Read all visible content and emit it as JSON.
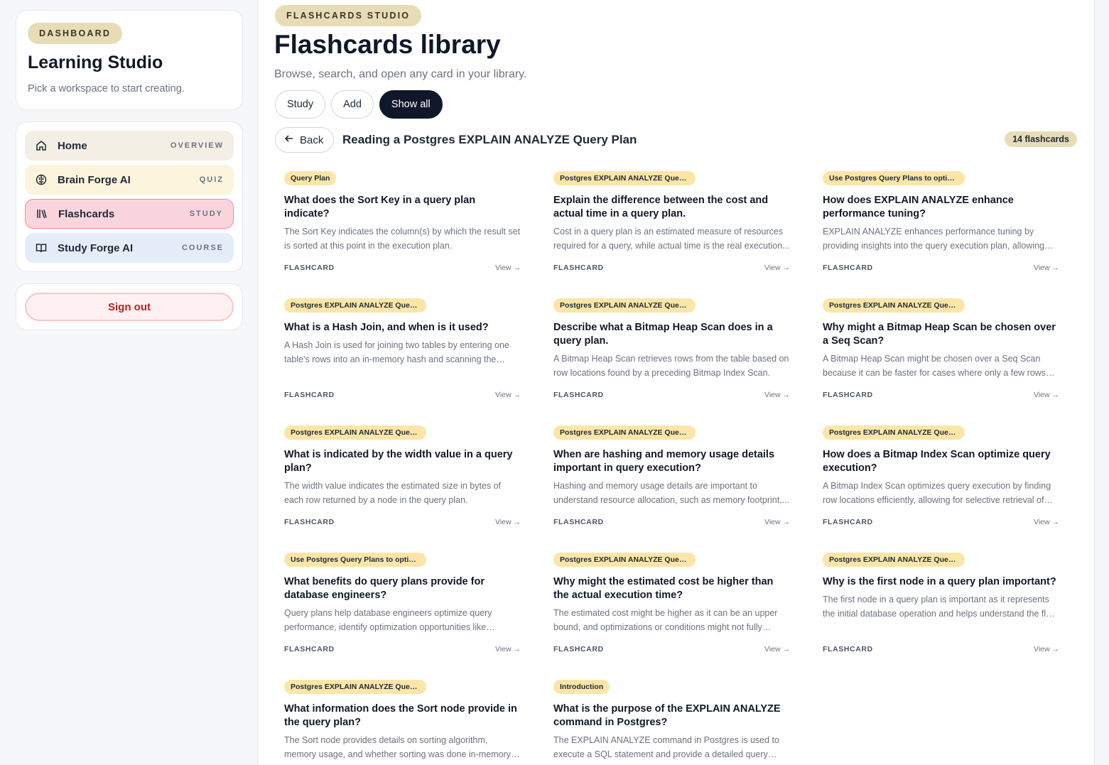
{
  "sidebar": {
    "badge": "DASHBOARD",
    "title": "Learning Studio",
    "subtitle": "Pick a workspace to start creating.",
    "nav": [
      {
        "label": "Home",
        "tag": "OVERVIEW",
        "icon": "home-icon"
      },
      {
        "label": "Brain Forge AI",
        "tag": "QUIZ",
        "icon": "brain-icon"
      },
      {
        "label": "Flashcards",
        "tag": "STUDY",
        "icon": "library-icon"
      },
      {
        "label": "Study Forge AI",
        "tag": "COURSE",
        "icon": "book-icon"
      }
    ],
    "signout": "Sign out"
  },
  "header": {
    "badge": "FLASHCARDS STUDIO",
    "title": "Flashcards library",
    "subtitle": "Browse, search, and open any card in your library.",
    "tabs": [
      "Study",
      "Add",
      "Show all"
    ],
    "active_tab": "Show all"
  },
  "deck": {
    "back_label": "Back",
    "title": "Reading a Postgres EXPLAIN ANALYZE Query Plan",
    "count": "14 flashcards"
  },
  "card_labels": {
    "kind": "FLASHCARD",
    "view": "View →"
  },
  "cards": [
    {
      "tag": "Query Plan",
      "question": "What does the Sort Key in a query plan indicate?",
      "answer": "The Sort Key indicates the column(s) by which the result set is sorted at this point in the execution plan."
    },
    {
      "tag": "Postgres EXPLAIN ANALYZE Query...",
      "question": "Explain the difference between the cost and actual time in a query plan.",
      "answer": "Cost in a query plan is an estimated measure of resources required for a query, while actual time is the real execution..."
    },
    {
      "tag": "Use Postgres Query Plans to optimi...",
      "question": "How does EXPLAIN ANALYZE enhance performance tuning?",
      "answer": "EXPLAIN ANALYZE enhances performance tuning by providing insights into the query execution plan, allowing for..."
    },
    {
      "tag": "Postgres EXPLAIN ANALYZE Query...",
      "question": "What is a Hash Join, and when is it used?",
      "answer": "A Hash Join is used for joining two tables by entering one table's rows into an in-memory hash and scanning the other..."
    },
    {
      "tag": "Postgres EXPLAIN ANALYZE Query...",
      "question": "Describe what a Bitmap Heap Scan does in a query plan.",
      "answer": "A Bitmap Heap Scan retrieves rows from the table based on row locations found by a preceding Bitmap Index Scan."
    },
    {
      "tag": "Postgres EXPLAIN ANALYZE Query...",
      "question": "Why might a Bitmap Heap Scan be chosen over a Seq Scan?",
      "answer": "A Bitmap Heap Scan might be chosen over a Seq Scan because it can be faster for cases where only a few rows nee..."
    },
    {
      "tag": "Postgres EXPLAIN ANALYZE Query...",
      "question": "What is indicated by the width value in a query plan?",
      "answer": "The width value indicates the estimated size in bytes of each row returned by a node in the query plan."
    },
    {
      "tag": "Postgres EXPLAIN ANALYZE Query...",
      "question": "When are hashing and memory usage details important in query execution?",
      "answer": "Hashing and memory usage details are important to understand resource allocation, such as memory footprint,..."
    },
    {
      "tag": "Postgres EXPLAIN ANALYZE Query...",
      "question": "How does a Bitmap Index Scan optimize query execution?",
      "answer": "A Bitmap Index Scan optimizes query execution by finding row locations efficiently, allowing for selective retrieval of dat..."
    },
    {
      "tag": "Use Postgres Query Plans to optimi...",
      "question": "What benefits do query plans provide for database engineers?",
      "answer": "Query plans help database engineers optimize query performance, identify optimization opportunities like adding..."
    },
    {
      "tag": "Postgres EXPLAIN ANALYZE Query...",
      "question": "Why might the estimated cost be higher than the actual execution time?",
      "answer": "The estimated cost might be higher as it can be an upper bound, and optimizations or conditions might not fully utilize..."
    },
    {
      "tag": "Postgres EXPLAIN ANALYZE Query...",
      "question": "Why is the first node in a query plan important?",
      "answer": "The first node in a query plan is important as it represents the initial database operation and helps understand the flow of..."
    },
    {
      "tag": "Postgres EXPLAIN ANALYZE Query...",
      "question": "What information does the Sort node provide in the query plan?",
      "answer": "The Sort node provides details on sorting algorithm, memory usage, and whether sorting was done in-memory or required..."
    },
    {
      "tag": "Introduction",
      "question": "What is the purpose of the EXPLAIN ANALYZE command in Postgres?",
      "answer": "The EXPLAIN ANALYZE command in Postgres is used to execute a SQL statement and provide a detailed query plan,..."
    }
  ]
}
